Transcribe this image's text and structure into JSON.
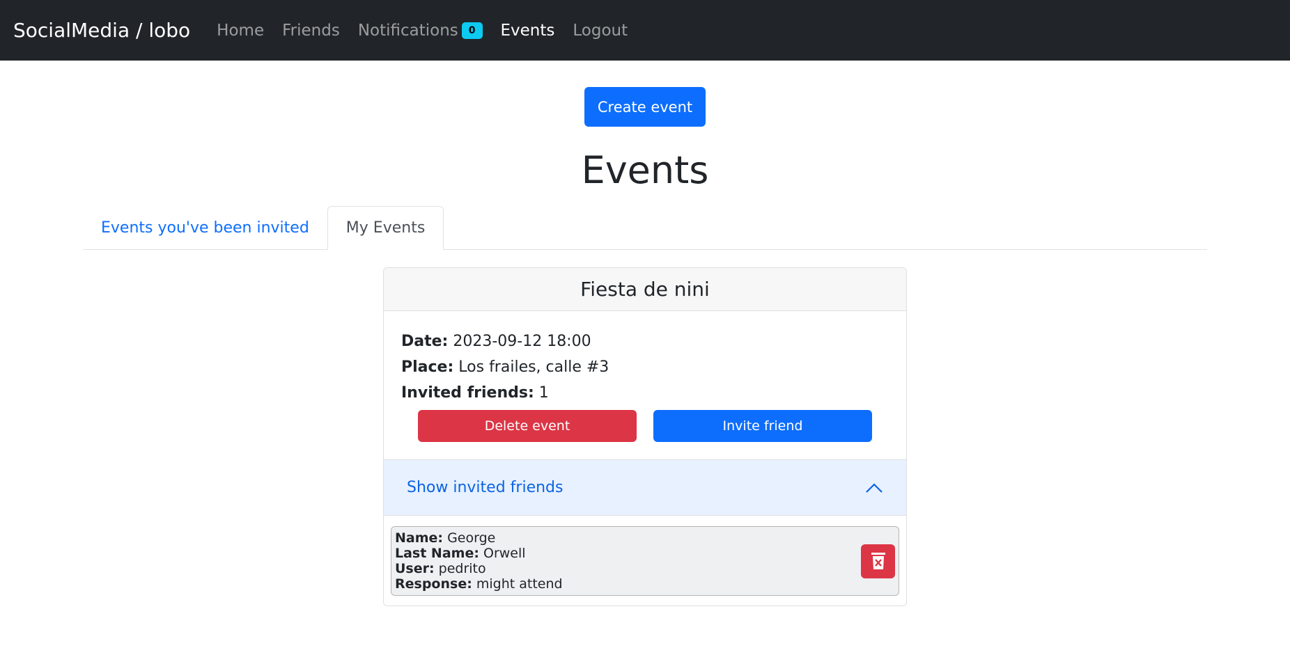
{
  "navbar": {
    "brand": "SocialMedia / lobo",
    "links": {
      "home": "Home",
      "friends": "Friends",
      "notifications": "Notifications",
      "notifications_count": "0",
      "events": "Events",
      "logout": "Logout"
    }
  },
  "actions": {
    "create_event": "Create event"
  },
  "page": {
    "title": "Events"
  },
  "tabs": {
    "invited": "Events you've been invited",
    "mine": "My Events"
  },
  "event": {
    "title": "Fiesta de nini",
    "date_label": "Date:",
    "date_value": "2023-09-12 18:00",
    "place_label": "Place:",
    "place_value": "Los frailes, calle #3",
    "invited_label": "Invited friends:",
    "invited_value": "1",
    "delete_label": "Delete event",
    "invite_label": "Invite friend",
    "accordion_label": "Show invited friends",
    "friends": [
      {
        "name_label": "Name:",
        "name": "George",
        "last_name_label": "Last Name:",
        "last_name": "Orwell",
        "user_label": "User:",
        "user": "pedrito",
        "response_label": "Response:",
        "response": "might attend"
      }
    ]
  },
  "icons": {
    "chevron": "chevron-up-icon",
    "remove": "trash-x-icon"
  },
  "colors": {
    "navbar": "#212529",
    "primary": "#0d6efd",
    "danger": "#dc3545",
    "badge": "#0dcaf0",
    "accordion": "#e7f1ff"
  }
}
